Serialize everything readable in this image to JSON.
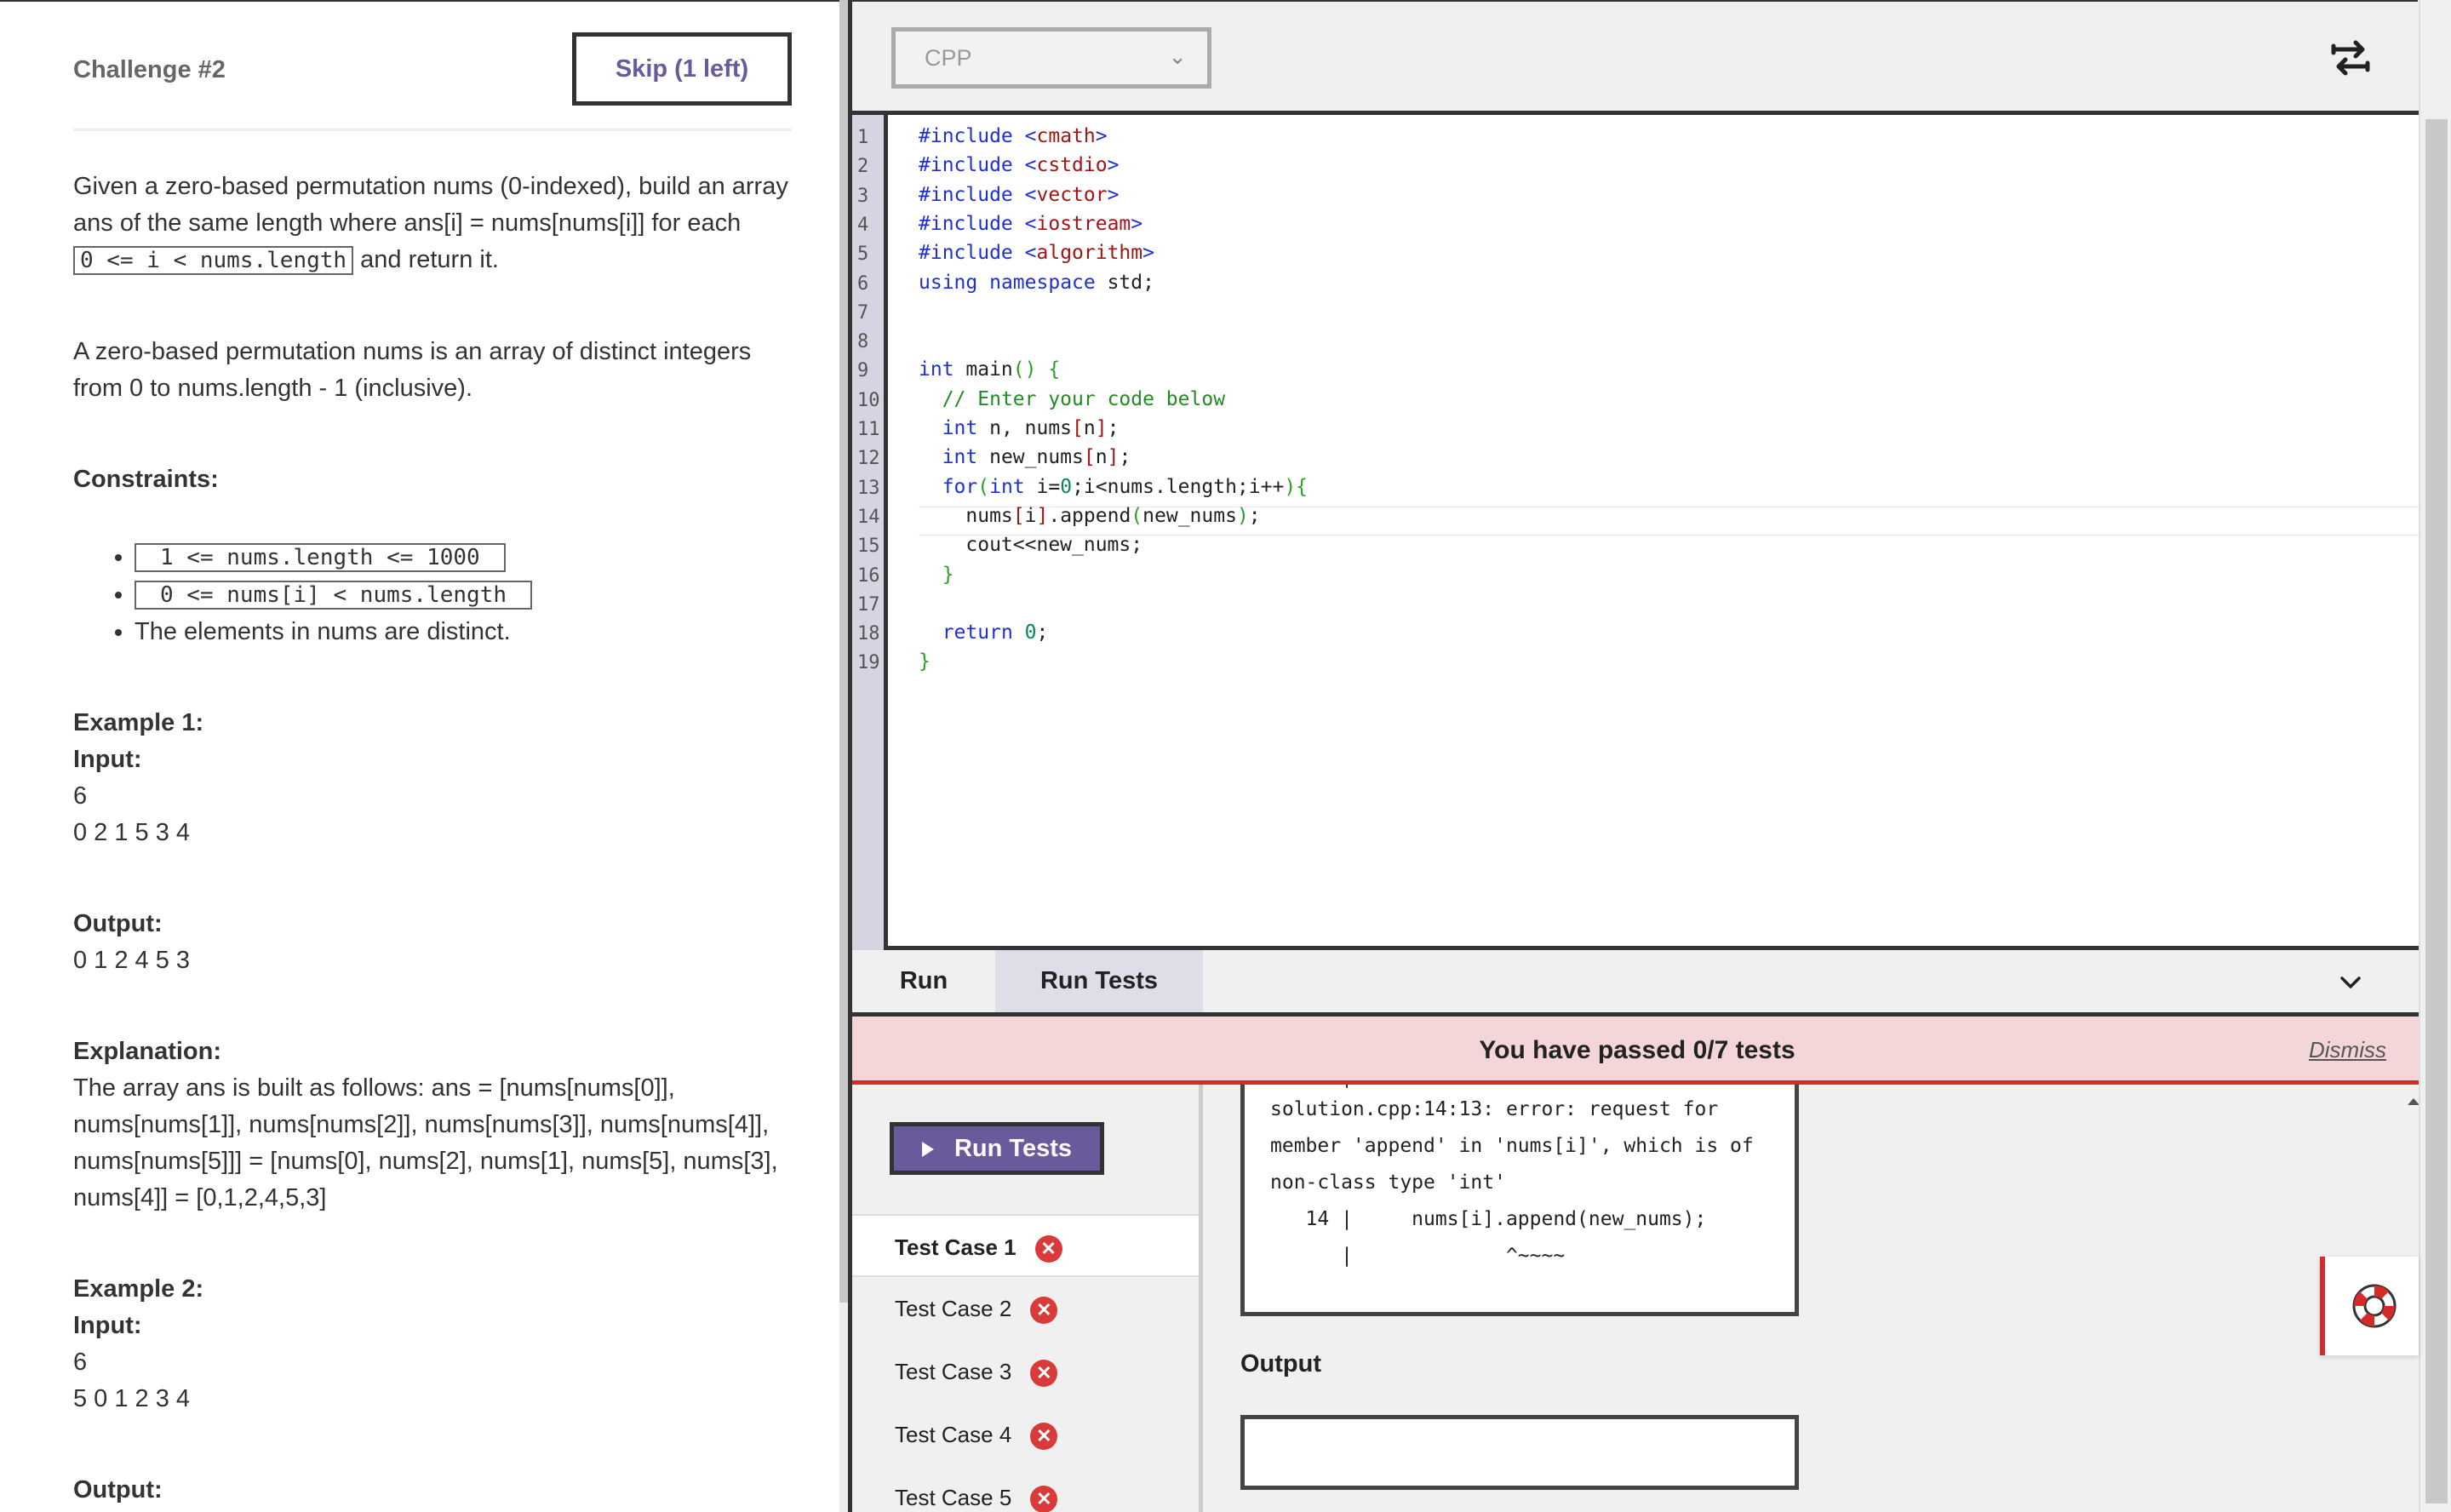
{
  "challenge": {
    "title": "Challenge #2",
    "skip_label": "Skip (1 left)"
  },
  "problem": {
    "intro_1": "Given a zero-based permutation nums (0-indexed), build an array ans of the same length where ans[i] = nums[nums[i]] for each",
    "intro_code": "0 <= i < nums.length",
    "intro_2": "and return it.",
    "definition": "A zero-based permutation nums is an array of distinct integers from 0 to nums.length - 1 (inclusive).",
    "constraints_heading": "Constraints:",
    "constraints": [
      "1 <= nums.length <= 1000",
      "0 <= nums[i] < nums.length"
    ],
    "constraint_text": "The elements in nums are distinct.",
    "example1": {
      "heading": "Example 1:",
      "input_label": "Input:",
      "input_lines": [
        "6",
        "0 2 1 5 3 4"
      ],
      "output_label": "Output:",
      "output_value": "0 1 2 4 5 3",
      "explanation_label": "Explanation:",
      "explanation": "The array ans is built as follows: ans = [nums[nums[0]], nums[nums[1]], nums[nums[2]], nums[nums[3]], nums[nums[4]], nums[nums[5]]] = [nums[0], nums[2], nums[1], nums[5], nums[3], nums[4]] = [0,1,2,4,5,3]"
    },
    "example2": {
      "heading": "Example 2:",
      "input_label": "Input:",
      "input_lines": [
        "6",
        "5 0 1 2 3 4"
      ],
      "output_label": "Output:"
    }
  },
  "editor": {
    "language": "CPP",
    "line_numbers": [
      "1",
      "2",
      "3",
      "4",
      "5",
      "6",
      "7",
      "8",
      "9",
      "10",
      "11",
      "12",
      "13",
      "14",
      "15",
      "16",
      "17",
      "18",
      "19"
    ],
    "code": [
      "#include <cmath>",
      "#include <cstdio>",
      "#include <vector>",
      "#include <iostream>",
      "#include <algorithm>",
      "using namespace std;",
      "",
      "",
      "int main() {",
      "  // Enter your code below",
      "  int n, nums[n];",
      "  int new_nums[n];",
      "  for(int i=0;i<nums.length;i++){",
      "    nums[i].append(new_nums);",
      "    cout<<new_nums;",
      "  }",
      "",
      "  return 0;",
      "}"
    ]
  },
  "bottom": {
    "tab_run": "Run",
    "tab_run_tests": "Run Tests",
    "result_text": "You have passed 0/7 tests",
    "dismiss": "Dismiss",
    "run_tests_button": "Run Tests",
    "test_cases": [
      "Test Case 1",
      "Test Case 2",
      "Test Case 3",
      "Test Case 4",
      "Test Case 5"
    ],
    "error_lines": [
      "      |              ^~~~~",
      "solution.cpp:14:13: error: request for",
      "member 'append' in 'nums[i]', which is of",
      "non-class type 'int'",
      "   14 |     nums[i].append(new_nums);",
      "      |             ^~~~~"
    ],
    "output_label": "Output",
    "output_value": ""
  },
  "colors": {
    "accent": "#6a5a9b",
    "fail": "#d93a3a",
    "banner_bg": "#f4d6d8"
  }
}
